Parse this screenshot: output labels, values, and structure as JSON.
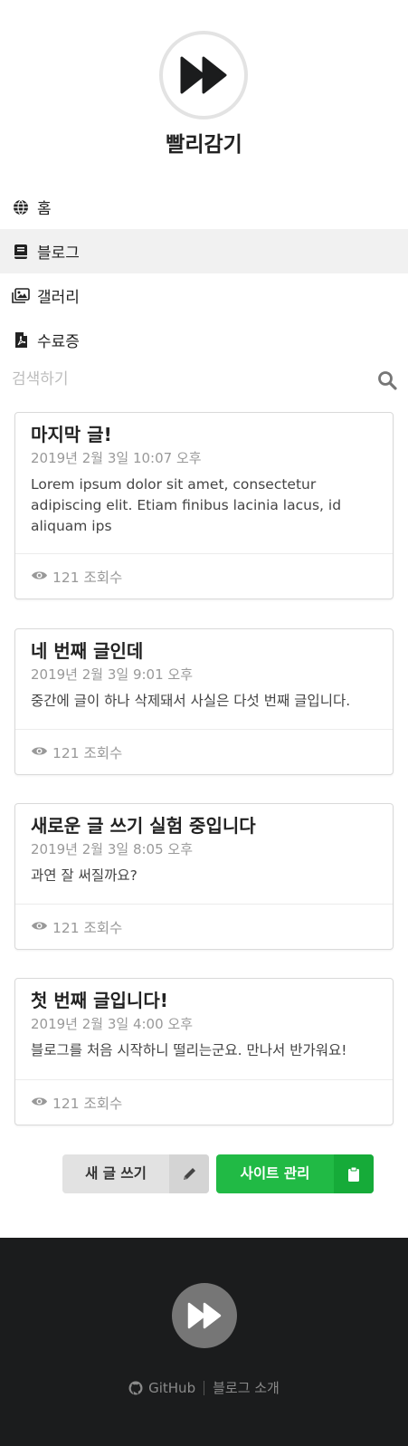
{
  "site": {
    "title": "빨리감기"
  },
  "nav": {
    "items": [
      {
        "label": "홈",
        "icon": "globe-icon",
        "active": false
      },
      {
        "label": "블로그",
        "icon": "book-icon",
        "active": true
      },
      {
        "label": "갤러리",
        "icon": "images-icon",
        "active": false
      },
      {
        "label": "수료증",
        "icon": "pdf-file-icon",
        "active": false
      }
    ]
  },
  "search": {
    "placeholder": "검색하기",
    "value": ""
  },
  "posts": [
    {
      "title": "마지막 글!",
      "date": "2019년 2월 3일 10:07 오후",
      "excerpt": "Lorem ipsum dolor sit amet, consectetur adipiscing elit. Etiam finibus lacinia lacus, id aliquam ips",
      "views": "121 조회수"
    },
    {
      "title": "네 번째 글인데",
      "date": "2019년 2월 3일 9:01 오후",
      "excerpt": "중간에 글이 하나 삭제돼서 사실은 다섯 번째 글입니다.",
      "views": "121 조회수"
    },
    {
      "title": "새로운 글 쓰기 실험 중입니다",
      "date": "2019년 2월 3일 8:05 오후",
      "excerpt": "과연 잘 써질까요?",
      "views": "121 조회수"
    },
    {
      "title": "첫 번째 글입니다!",
      "date": "2019년 2월 3일 4:00 오후",
      "excerpt": "블로그를 처음 시작하니 떨리는군요. 만나서 반가워요!",
      "views": "121 조회수"
    }
  ],
  "actions": {
    "write_label": "새 글 쓰기",
    "write_icon": "pencil-icon",
    "admin_label": "사이트 관리",
    "admin_icon": "clipboard-icon"
  },
  "footer": {
    "github_label": "GitHub",
    "about_label": "블로그 소개"
  },
  "colors": {
    "accent_green": "#21ba45",
    "footer_bg": "#1b1c1d",
    "active_nav_bg": "#f1f1f1"
  }
}
